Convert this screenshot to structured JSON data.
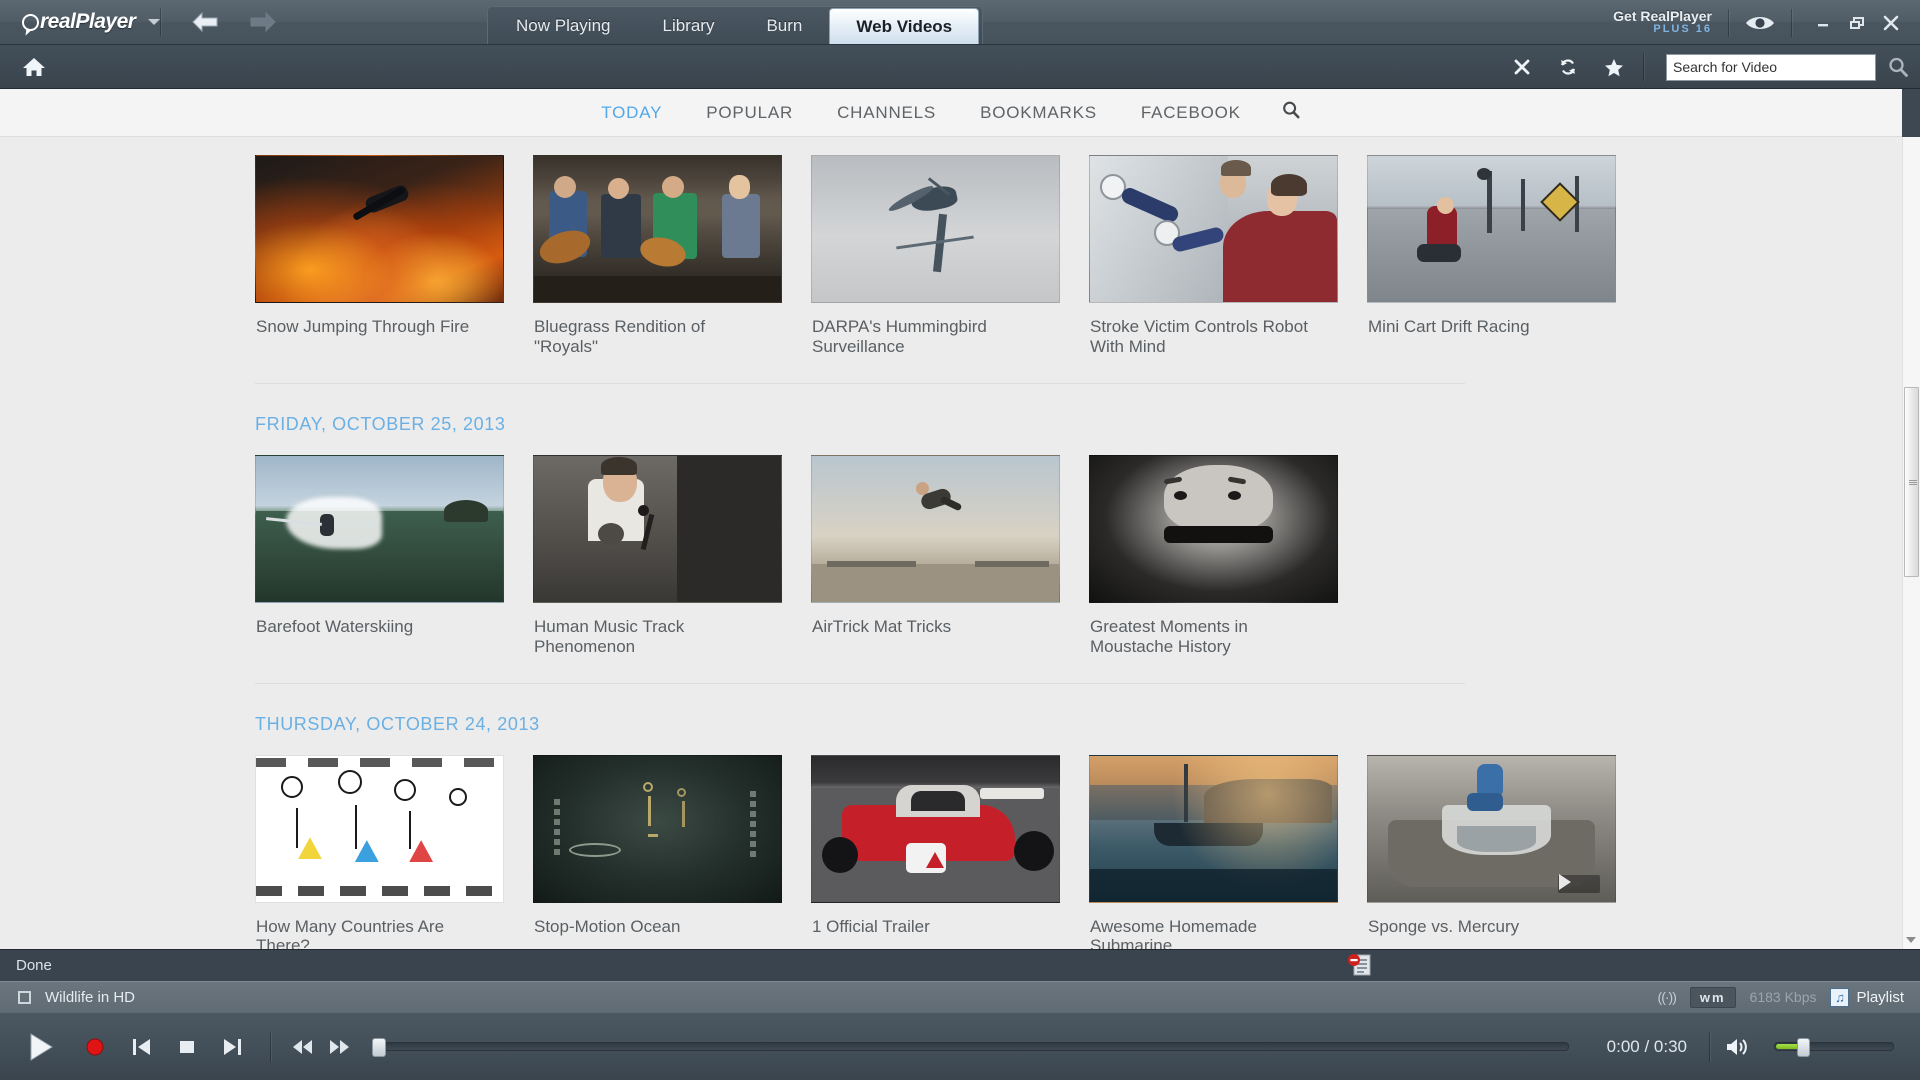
{
  "app": {
    "brand_primary": "real",
    "brand_secondary": "Player",
    "accent_blue": "#52a8e8",
    "chrome_dark": "#434f59"
  },
  "titlebar": {
    "menu_caret": "chevron-down-icon",
    "back_label": "Back",
    "forward_label": "Forward",
    "tabs": [
      {
        "label": "Now Playing",
        "active": false
      },
      {
        "label": "Library",
        "active": false
      },
      {
        "label": "Burn",
        "active": false
      },
      {
        "label": "Web Videos",
        "active": true
      }
    ],
    "promo_line1": "Get RealPlayer",
    "promo_line2": "PLUS 16",
    "eye_icon": "eye-icon",
    "minimize": "–",
    "restore": "❐",
    "close": "✕"
  },
  "toolbar": {
    "home_icon": "home-icon",
    "stop_icon": "✕",
    "refresh_icon": "refresh-icon",
    "favorites_icon": "★",
    "search": {
      "value": "Search for Video",
      "placeholder": "Search for Video",
      "go_icon": "search-icon"
    }
  },
  "webnav": {
    "items": [
      {
        "label": "TODAY",
        "active": true
      },
      {
        "label": "POPULAR",
        "active": false
      },
      {
        "label": "CHANNELS",
        "active": false
      },
      {
        "label": "BOOKMARKS",
        "active": false
      },
      {
        "label": "FACEBOOK",
        "active": false
      }
    ],
    "search_icon": "search-icon"
  },
  "content": {
    "groups": [
      {
        "date": "",
        "videos": [
          {
            "title": "Snow Jumping Through Fire",
            "thumb": "snow-fire"
          },
          {
            "title": "Bluegrass Rendition of \"Royals\"",
            "thumb": "bluegrass"
          },
          {
            "title": "DARPA's Hummingbird Surveillance",
            "thumb": "hummingbird"
          },
          {
            "title": "Stroke Victim Controls Robot With Mind",
            "thumb": "robot-arm"
          },
          {
            "title": "Mini Cart Drift Racing",
            "thumb": "mini-cart"
          }
        ]
      },
      {
        "date": "FRIDAY, OCTOBER 25, 2013",
        "videos": [
          {
            "title": "Barefoot Waterskiing",
            "thumb": "waterski"
          },
          {
            "title": "Human Music Track Phenomenon",
            "thumb": "human-music"
          },
          {
            "title": "AirTrick Mat Tricks",
            "thumb": "airtrick"
          },
          {
            "title": "Greatest Moments in Moustache History",
            "thumb": "moustache"
          }
        ]
      },
      {
        "date": "THURSDAY, OCTOBER 24, 2013",
        "videos": [
          {
            "title": "How Many Countries Are There?",
            "thumb": "countries"
          },
          {
            "title": "Stop-Motion Ocean",
            "thumb": "stopmotion"
          },
          {
            "title": "1 Official Trailer",
            "thumb": "f1-trailer"
          },
          {
            "title": "Awesome Homemade Submarine",
            "thumb": "submarine"
          },
          {
            "title": "Sponge vs. Mercury",
            "thumb": "sponge"
          }
        ]
      }
    ]
  },
  "statusbar": {
    "message": "Done",
    "page_icon": "page-blocked-icon"
  },
  "nowplaying": {
    "checkbox_state": "unchecked",
    "title": "Wildlife in HD",
    "connection_icon": "((·))",
    "codec_badge": "wm",
    "bitrate": "6183 Kbps",
    "playlist_icon": "music-note-icon",
    "playlist_label": "Playlist"
  },
  "transport": {
    "play": "play-icon",
    "record": "record-icon",
    "previous": "previous-track-icon",
    "stop": "stop-icon",
    "next": "next-track-icon",
    "rewind": "rewind-icon",
    "fastforward": "fast-forward-icon",
    "elapsed": "0:00",
    "duration": "0:30",
    "timecode": "0:00 / 0:30",
    "mute_icon": "speaker-icon",
    "volume_percent": 20,
    "seek_percent": 0
  }
}
